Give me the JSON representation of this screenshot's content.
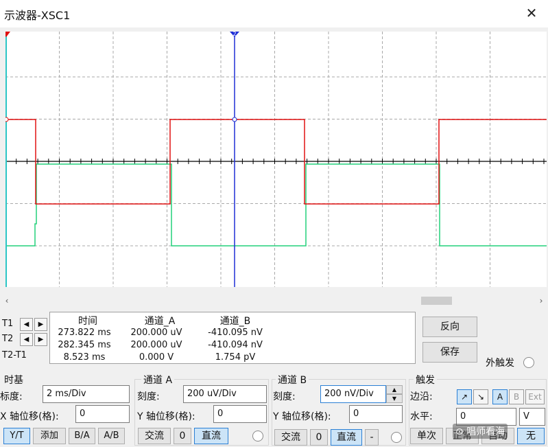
{
  "window": {
    "title": "示波器-XSC1",
    "close_glyph": "✕"
  },
  "scope": {
    "background": "#ffffff",
    "grid_color": "#a8a8a8",
    "axis_color": "#000000",
    "channel_a_color": "#e01010",
    "channel_b_color": "#22d07a",
    "cursor1_color": "#2bc6c6",
    "cursor2_color": "#1f2fd6",
    "cursor1_label": "1",
    "cursor2_label": "2"
  },
  "cursors": {
    "t1_label": "T1",
    "t2_label": "T2",
    "diff_label": "T2-T1",
    "left_arrow": "◀",
    "right_arrow": "▶",
    "headers": {
      "time": "时间",
      "channel_a": "通道_A",
      "channel_b": "通道_B"
    },
    "rows": [
      {
        "time": "273.822 ms",
        "a": "200.000 uV",
        "b": "-410.095 nV"
      },
      {
        "time": "282.345 ms",
        "a": "200.000 uV",
        "b": "-410.094 nV"
      },
      {
        "time": "8.523 ms",
        "a": "0.000 V",
        "b": "1.754 pV"
      }
    ]
  },
  "buttons": {
    "reverse": "反向",
    "save": "保存"
  },
  "ext_trigger_label": "外触发",
  "timebase": {
    "title": "时基",
    "scale_label": "标度:",
    "scale_value": "2 ms/Div",
    "xpos_label": "X 轴位移(格):",
    "xpos_value": "0",
    "modes": [
      "Y/T",
      "添加",
      "B/A",
      "A/B"
    ]
  },
  "channel_a": {
    "title": "通道 A",
    "scale_label": "刻度:",
    "scale_value": "200 uV/Div",
    "ypos_label": "Y 轴位移(格):",
    "ypos_value": "0",
    "coupling": [
      "交流",
      "0",
      "直流"
    ]
  },
  "channel_b": {
    "title": "通道 B",
    "scale_label": "刻度:",
    "scale_value": "200 nV/Div",
    "ypos_label": "Y 轴位移(格):",
    "ypos_value": "0",
    "coupling": [
      "交流",
      "0",
      "直流",
      "-"
    ]
  },
  "trigger": {
    "title": "触发",
    "edge_label": "边沿:",
    "edge_rise": "↗",
    "edge_fall": "↘",
    "sources": [
      "A",
      "B",
      "Ext"
    ],
    "level_label": "水平:",
    "level_value": "0",
    "level_unit": "V",
    "modes": [
      "单次",
      "正常",
      "自动",
      "无"
    ]
  },
  "watermark": "唱师看海"
}
